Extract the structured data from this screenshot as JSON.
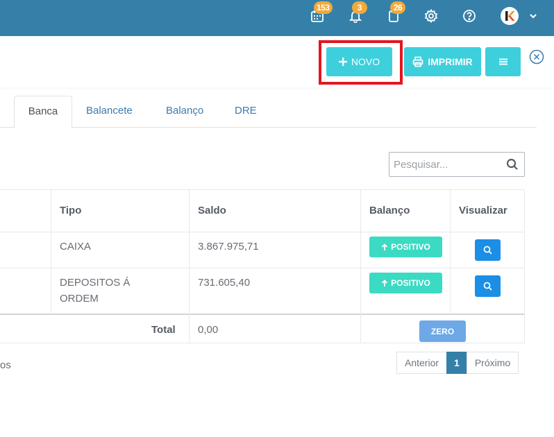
{
  "topbar": {
    "calendar_badge": "153",
    "bell_badge": "3",
    "clipboard_badge": "26",
    "avatar_letter": "K"
  },
  "actions": {
    "novo_label": "NOVO",
    "imprimir_label": "IMPRIMIR"
  },
  "tabs": [
    "Banca",
    "Balancete",
    "Balanço",
    "DRE"
  ],
  "search": {
    "placeholder": "Pesquisar..."
  },
  "table": {
    "headers": {
      "tipo": "Tipo",
      "saldo": "Saldo",
      "balanco": "Balanço",
      "visualizar": "Visualizar"
    },
    "rows": [
      {
        "tipo_line1": "CAIXA",
        "tipo_line2": "",
        "saldo": "3.867.975,71",
        "balanco": "POSITIVO"
      },
      {
        "tipo_line1": "DEPOSITOS Á",
        "tipo_line2": "ORDEM",
        "saldo": "731.605,40",
        "balanco": "POSITIVO"
      }
    ],
    "total_label": "Total",
    "total_value": "0,00",
    "total_status": "ZERO"
  },
  "footer": {
    "info_fragment": "os",
    "pagination": {
      "prev": "Anterior",
      "current": "1",
      "next": "Próximo"
    }
  },
  "colors": {
    "topbar": "#3580a8",
    "button": "#3ecfdc",
    "positive": "#3bdac3",
    "view": "#1b8ee5",
    "zero": "#6ea8e6",
    "highlight": "#e3161e",
    "badge": "#f2a93b"
  }
}
